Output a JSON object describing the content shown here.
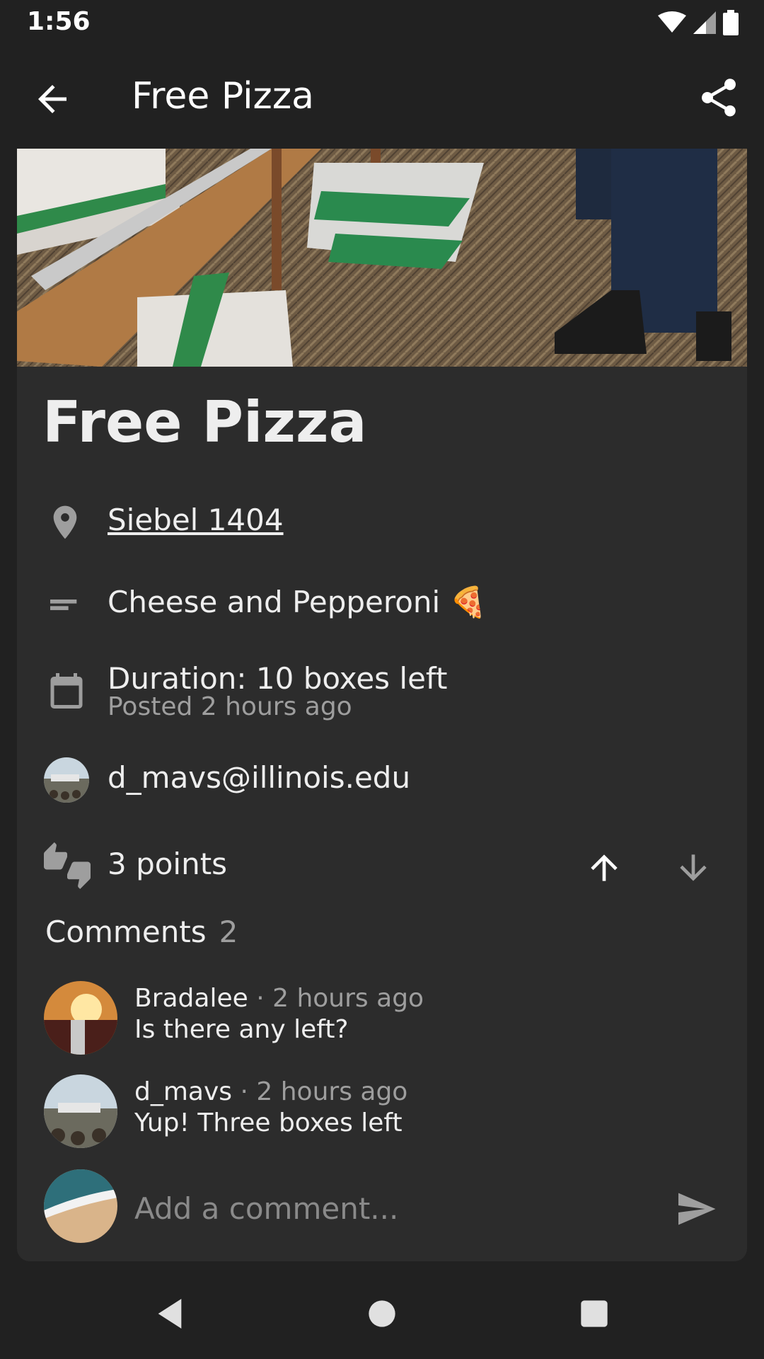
{
  "status_bar": {
    "time": "1:56"
  },
  "app_bar": {
    "title": "Free Pizza"
  },
  "post": {
    "title": "Free Pizza",
    "location": "Siebel 1404",
    "description": "Cheese and Pepperoni 🍕",
    "duration": "Duration: 10 boxes left",
    "posted": "Posted 2 hours ago",
    "author": "d_mavs@illinois.edu",
    "points": "3 points"
  },
  "comments": {
    "title": "Comments",
    "count": "2",
    "items": [
      {
        "user": "Bradalee",
        "time": "· 2 hours ago",
        "text": "Is there any left?"
      },
      {
        "user": "d_mavs",
        "time": "· 2 hours ago",
        "text": "Yup! Three boxes left"
      }
    ]
  },
  "add_comment": {
    "placeholder": "Add a comment..."
  },
  "colors": {
    "background": "#212121",
    "card": "#2c2c2c",
    "secondary_text": "#9e9e9e"
  }
}
